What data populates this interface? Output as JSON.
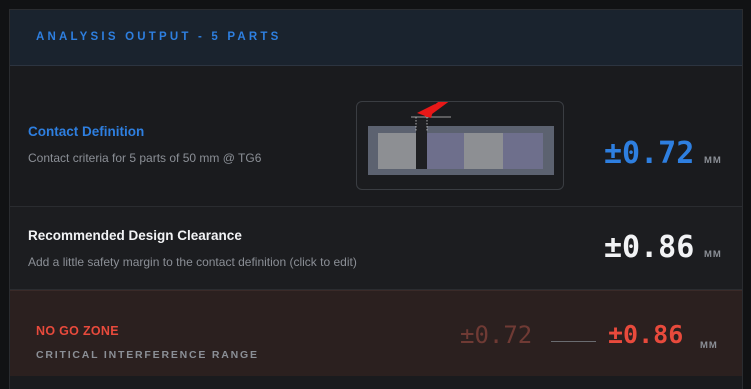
{
  "header": {
    "title": "ANALYSIS OUTPUT - 5 PARTS"
  },
  "contact": {
    "title": "Contact Definition",
    "subtitle": "Contact criteria for 5 parts of 50 mm @ TG6",
    "value": "±0.72",
    "unit": "MM"
  },
  "clearance": {
    "title": "Recommended Design Clearance",
    "subtitle": "Add a little safety margin to the contact definition (click to edit)",
    "value": "±0.86",
    "unit": "MM"
  },
  "nogo": {
    "title": "NO GO ZONE",
    "subtitle": "CRITICAL INTERFERENCE RANGE",
    "low": "±0.72",
    "high": "±0.86",
    "unit": "MM"
  },
  "colors": {
    "accent": "#2e7fe0",
    "danger": "#e84a3c",
    "arrow": "#e81818"
  }
}
